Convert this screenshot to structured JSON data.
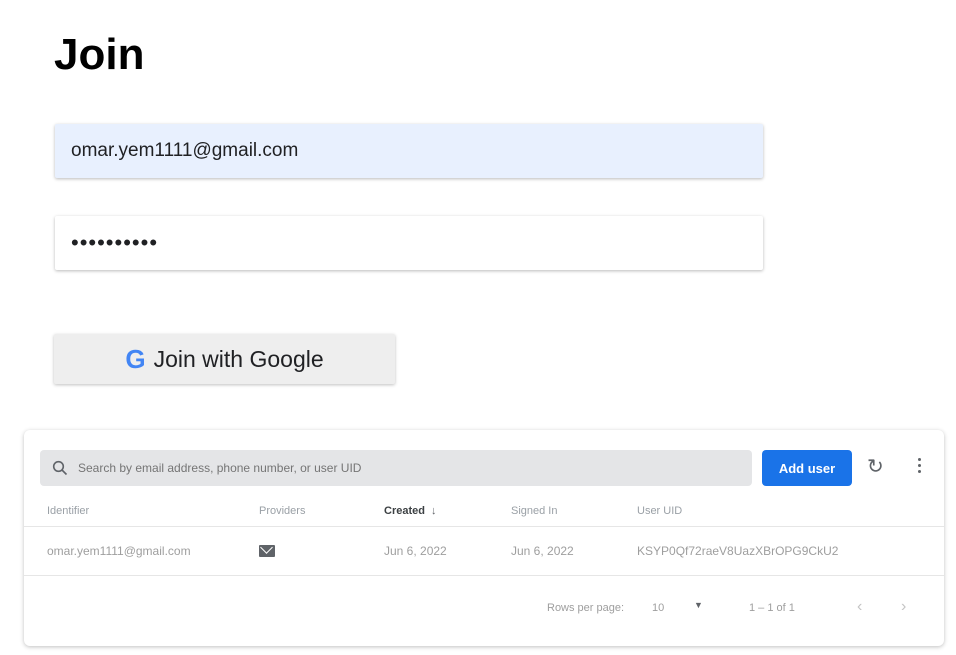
{
  "form": {
    "title": "Join",
    "email_value": "omar.yem1111@gmail.com",
    "password_mask": "••••••••••",
    "google_icon": "G",
    "google_button_label": "Join with Google"
  },
  "users_panel": {
    "search_placeholder": "Search by email address, phone number, or user UID",
    "add_user_label": "Add user",
    "refresh_icon": "refresh-icon",
    "more_icon": "more-vert-icon",
    "columns": [
      "Identifier",
      "Providers",
      "Created",
      "Signed In",
      "User UID"
    ],
    "sort_indicator": "↓",
    "rows": [
      {
        "identifier": "omar.yem1111@gmail.com",
        "provider_icon": "mail-icon",
        "created": "Jun 6, 2022",
        "signed_in": "Jun 6, 2022",
        "uid": "KSYP0Qf72raeV8UazXBrOPG9CkU2"
      }
    ],
    "pagination": {
      "rows_per_page_label": "Rows per page:",
      "rows_per_page_value": "10",
      "range_text": "1 – 1 of 1",
      "prev_icon": "‹",
      "next_icon": "›"
    }
  },
  "colors": {
    "email_field_bg": "#e8f0fe",
    "primary_button": "#1a73e8",
    "google_button_bg": "#eeeeee"
  }
}
